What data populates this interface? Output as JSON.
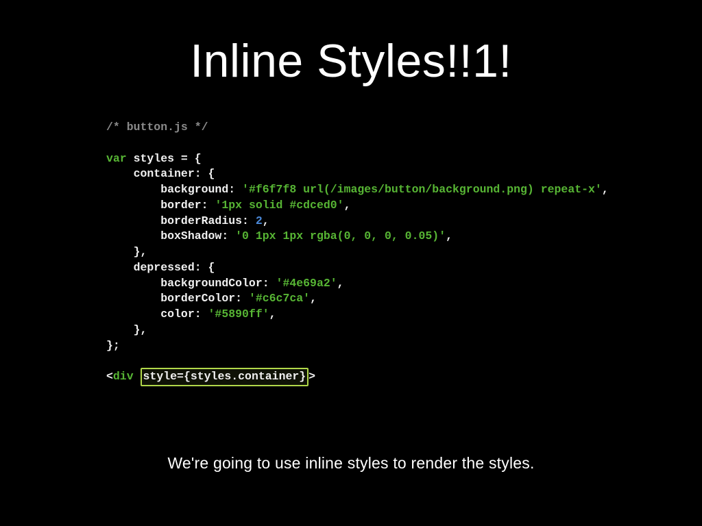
{
  "title": "Inline Styles!!1!",
  "caption": "We're going to use inline styles to render the styles.",
  "code": {
    "comment": "/* button.js */",
    "var_kw": "var",
    "styles_decl": " styles = {",
    "container_key": "    container: {",
    "bg_key": "        background: ",
    "bg_val": "'#f6f7f8 url(/images/button/background.png) repeat-x'",
    "border_key": "        border: ",
    "border_val": "'1px solid #cdced0'",
    "radius_key": "        borderRadius: ",
    "radius_val": "2",
    "shadow_key": "        boxShadow: ",
    "shadow_val": "'0 1px 1px rgba(0, 0, 0, 0.05)'",
    "close1": "    },",
    "depressed_key": "    depressed: {",
    "bgcolor_key": "        backgroundColor: ",
    "bgcolor_val": "'#4e69a2'",
    "bordercolor_key": "        borderColor: ",
    "bordercolor_val": "'#c6c7ca'",
    "color_key": "        color: ",
    "color_val": "'#5890ff'",
    "close2": "    },",
    "close3": "};",
    "jsx_open": "<",
    "jsx_tag": "div",
    "jsx_space": " ",
    "jsx_attr": "style={styles.container}",
    "jsx_close": ">"
  }
}
